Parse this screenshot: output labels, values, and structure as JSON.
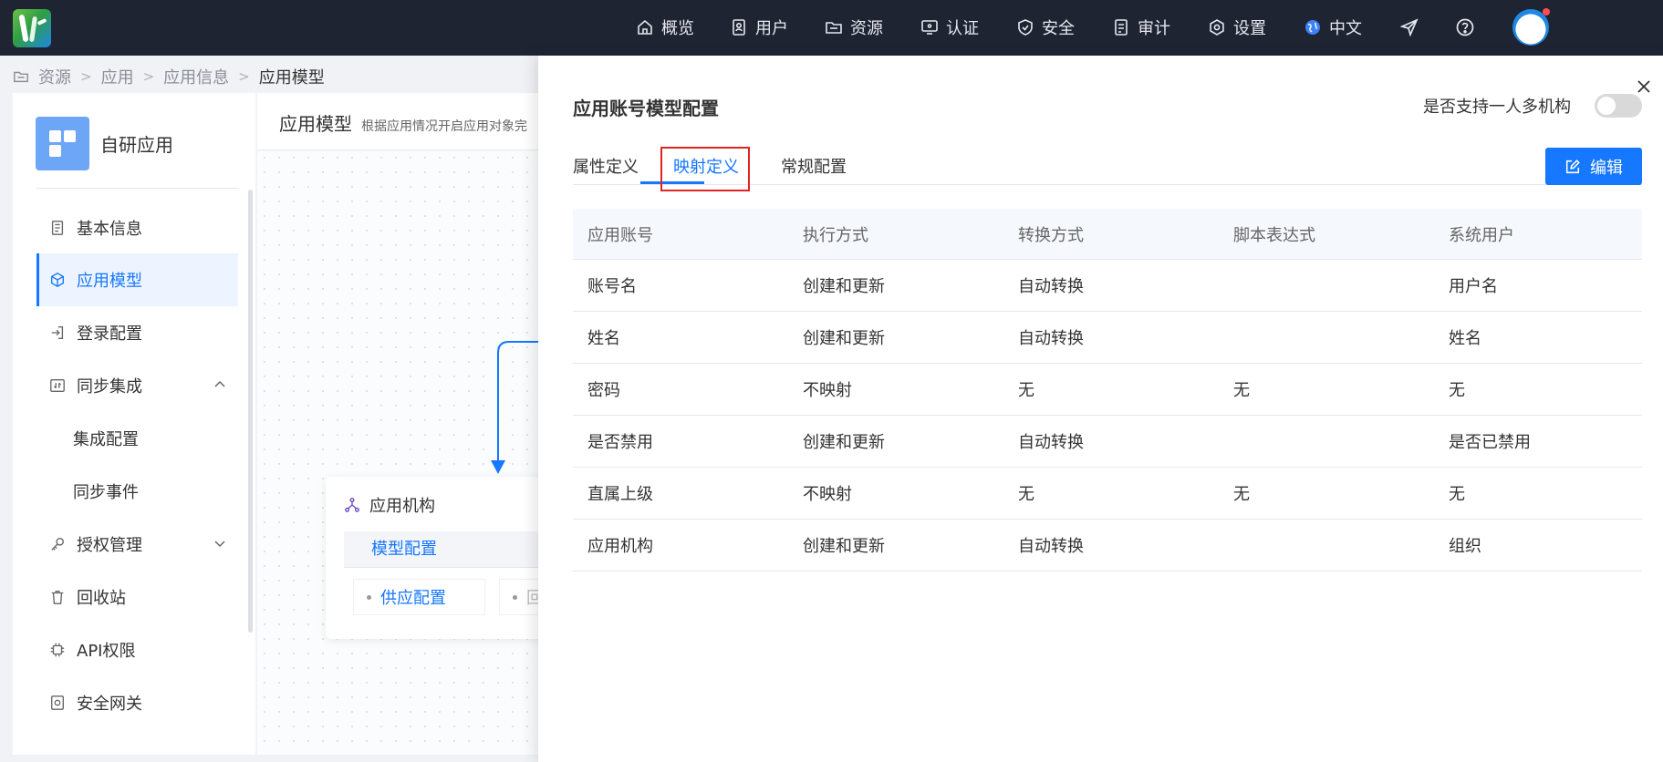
{
  "nav": {
    "items": [
      {
        "label": "概览",
        "icon": "home-icon"
      },
      {
        "label": "用户",
        "icon": "user-icon"
      },
      {
        "label": "资源",
        "icon": "folder-icon"
      },
      {
        "label": "认证",
        "icon": "monitor-icon"
      },
      {
        "label": "安全",
        "icon": "shield-icon"
      },
      {
        "label": "审计",
        "icon": "audit-icon"
      },
      {
        "label": "设置",
        "icon": "settings-icon"
      },
      {
        "label": "中文",
        "icon": "globe-icon"
      }
    ]
  },
  "breadcrumb": [
    "资源",
    "应用",
    "应用信息",
    "应用模型"
  ],
  "sidebar": {
    "app_name": "自研应用",
    "items": [
      {
        "label": "基本信息",
        "icon": "document-icon"
      },
      {
        "label": "应用模型",
        "icon": "cube-icon"
      },
      {
        "label": "登录配置",
        "icon": "login-icon"
      },
      {
        "label": "同步集成",
        "icon": "sync-icon"
      },
      {
        "label": "集成配置"
      },
      {
        "label": "同步事件"
      },
      {
        "label": "授权管理",
        "icon": "key-icon"
      },
      {
        "label": "回收站",
        "icon": "trash-icon"
      },
      {
        "label": "API权限",
        "icon": "chip-icon"
      },
      {
        "label": "安全网关",
        "icon": "gateway-icon"
      }
    ]
  },
  "canvas": {
    "title": "应用模型",
    "desc": "根据应用情况开启应用对象完",
    "node_title": "应用机构",
    "node_tab": "模型配置",
    "chip1": "供应配置",
    "chip2": "回"
  },
  "drawer": {
    "title": "应用账号模型配置",
    "toggle_label": "是否支持一人多机构",
    "toggle_on": false,
    "tabs": [
      "属性定义",
      "映射定义",
      "常规配置"
    ],
    "active_tab": "映射定义",
    "edit_label": "编辑",
    "table": {
      "headers": [
        "应用账号",
        "执行方式",
        "转换方式",
        "脚本表达式",
        "系统用户"
      ],
      "rows": [
        [
          "账号名",
          "创建和更新",
          "自动转换",
          "",
          "用户名"
        ],
        [
          "姓名",
          "创建和更新",
          "自动转换",
          "",
          "姓名"
        ],
        [
          "密码",
          "不映射",
          "无",
          "无",
          "无"
        ],
        [
          "是否禁用",
          "创建和更新",
          "自动转换",
          "",
          "是否已禁用"
        ],
        [
          "直属上级",
          "不映射",
          "无",
          "无",
          "无"
        ],
        [
          "应用机构",
          "创建和更新",
          "自动转换",
          "",
          "组织"
        ]
      ]
    }
  },
  "colors": {
    "primary": "#1677ff",
    "topbar": "#1f2433",
    "highlight": "#e02424"
  }
}
